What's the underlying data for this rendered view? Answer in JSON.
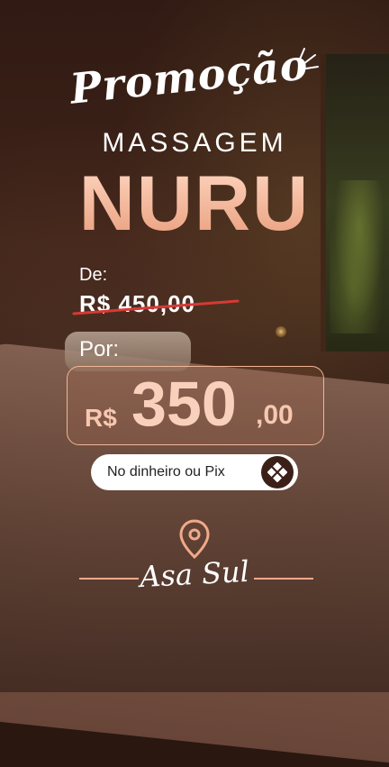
{
  "headline": {
    "script_title": "Promoção",
    "subtitle": "MASSAGEM",
    "title": "NURU"
  },
  "pricing": {
    "old_label": "De:",
    "old_price": "R$ 450,00",
    "new_label": "Por:",
    "currency": "R$",
    "new_price_integer": "350",
    "new_price_cents": ",00"
  },
  "payment": {
    "label": "No dinheiro ou Pix",
    "icon": "pix-icon"
  },
  "location": {
    "icon": "map-pin-icon",
    "name": "Asa Sul"
  },
  "colors": {
    "accent": "#f1a98a",
    "title_gradient_top": "#ffd9c4",
    "title_gradient_bottom": "#e89a78",
    "strike": "#d63a35",
    "pill_bg": "#ffffff",
    "text": "#ffffff"
  }
}
